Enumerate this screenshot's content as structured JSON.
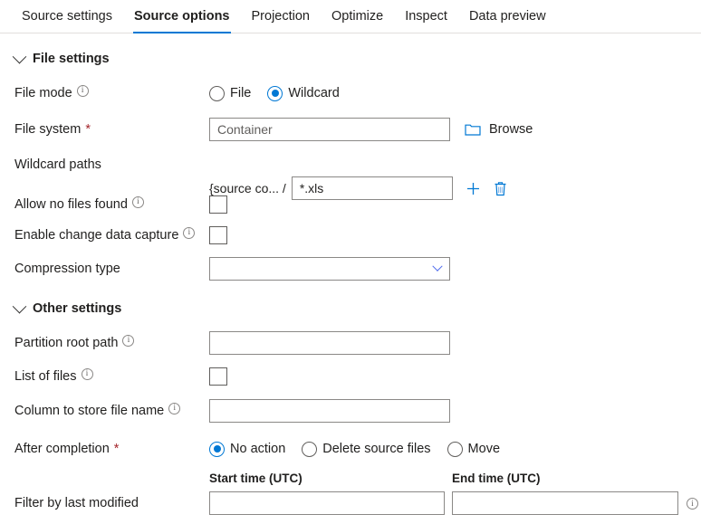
{
  "tabs": [
    {
      "label": "Source settings",
      "active": false
    },
    {
      "label": "Source options",
      "active": true
    },
    {
      "label": "Projection",
      "active": false
    },
    {
      "label": "Optimize",
      "active": false
    },
    {
      "label": "Inspect",
      "active": false
    },
    {
      "label": "Data preview",
      "active": false
    }
  ],
  "colors": {
    "accent": "#0078d4",
    "required": "#a4262c",
    "border": "#8a8886",
    "text": "#201f1e"
  },
  "file_settings": {
    "section_title": "File settings",
    "file_mode": {
      "label": "File mode",
      "has_info": true,
      "options": [
        "File",
        "Wildcard"
      ],
      "selected": "Wildcard"
    },
    "file_system": {
      "label": "File system",
      "required": "*",
      "value": "",
      "placeholder": "Container",
      "browse_label": "Browse",
      "browse_icon": "folder-icon"
    },
    "wildcard_paths": {
      "label": "Wildcard paths",
      "prefix": "{source co... /",
      "value": "*.xls",
      "placeholder": "",
      "add_icon": "plus-icon",
      "delete_icon": "trash-icon"
    },
    "allow_no_files_found": {
      "label": "Allow no files found",
      "has_info": true,
      "checked": false
    },
    "enable_change_data_capture": {
      "label": "Enable change data capture",
      "has_info": true,
      "checked": false
    },
    "compression_type": {
      "label": "Compression type",
      "value": "",
      "chevron_icon": "chevron-down-icon"
    }
  },
  "other_settings": {
    "section_title": "Other settings",
    "partition_root_path": {
      "label": "Partition root path",
      "has_info": true,
      "value": "",
      "placeholder": ""
    },
    "list_of_files": {
      "label": "List of files",
      "has_info": true,
      "checked": false
    },
    "column_to_store_file_name": {
      "label": "Column to store file name",
      "has_info": true,
      "value": "",
      "placeholder": ""
    },
    "after_completion": {
      "label": "After completion",
      "required": "*",
      "options": [
        "No action",
        "Delete source files",
        "Move"
      ],
      "selected": "No action"
    },
    "filter_by_last_modified": {
      "label": "Filter by last modified",
      "start_label": "Start time (UTC)",
      "start_value": "",
      "start_placeholder": "",
      "end_label": "End time (UTC)",
      "end_value": "",
      "end_placeholder": "",
      "has_info": true
    }
  }
}
